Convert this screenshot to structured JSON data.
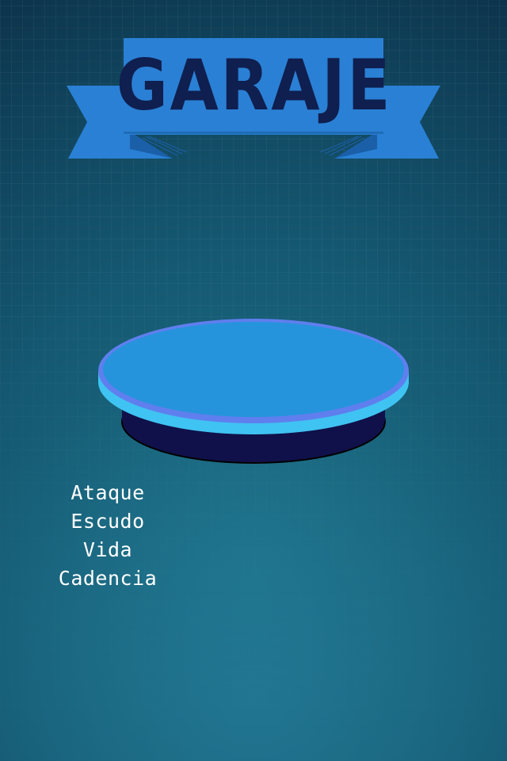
{
  "screen": {
    "title": "GARAJE"
  },
  "stats": [
    {
      "label": "Ataque"
    },
    {
      "label": "Escudo"
    },
    {
      "label": "Vida"
    },
    {
      "label": "Cadencia"
    }
  ],
  "colors": {
    "background": "#155a73",
    "banner": "#2a80d4",
    "banner_text": "#0f1f4f",
    "platform_top": "#2594dc",
    "platform_rim": "#5f7fee",
    "platform_glow": "#3fc3f2",
    "platform_base": "#10114a"
  }
}
